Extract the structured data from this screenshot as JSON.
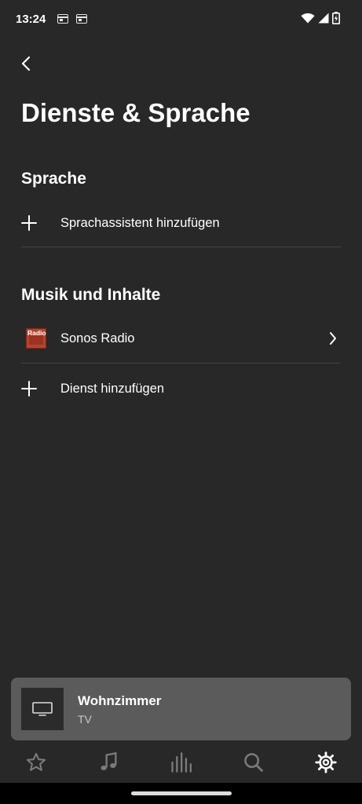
{
  "status_bar": {
    "time": "13:24",
    "left_icons": [
      "calendar-widget-icon",
      "calendar-widget-icon"
    ],
    "right_icons": [
      "wifi-icon",
      "cellular-signal-icon",
      "battery-charging-icon"
    ]
  },
  "header": {
    "back_icon": "chevron-left-icon",
    "title": "Dienste & Sprache"
  },
  "sections": [
    {
      "heading": "Sprache",
      "items": [
        {
          "icon": "plus-icon",
          "label": "Sprachassistent hinzufügen"
        }
      ]
    },
    {
      "heading": "Musik und Inhalte",
      "items": [
        {
          "icon": "sonos-radio-logo",
          "label": "Sonos Radio",
          "logo_text": "Radio",
          "chevron": "chevron-right-icon"
        },
        {
          "icon": "plus-icon",
          "label": "Dienst hinzufügen"
        }
      ]
    }
  ],
  "now_playing": {
    "room": "Wohnzimmer",
    "source": "TV",
    "thumb_icon": "tv-icon"
  },
  "bottom_nav": {
    "items": [
      {
        "name": "favorites",
        "icon": "star-icon",
        "active": false
      },
      {
        "name": "browse",
        "icon": "music-note-icon",
        "active": false
      },
      {
        "name": "rooms",
        "icon": "equalizer-bars-icon",
        "active": false
      },
      {
        "name": "search",
        "icon": "search-icon",
        "active": false
      },
      {
        "name": "settings",
        "icon": "gear-icon",
        "active": true
      }
    ]
  },
  "colors": {
    "background": "#282828",
    "divider": "#444444",
    "now_playing_bg": "#5b5b5b",
    "nav_inactive": "#7a7a7a",
    "nav_active": "#ffffff",
    "radio_logo": "#b8432a"
  }
}
